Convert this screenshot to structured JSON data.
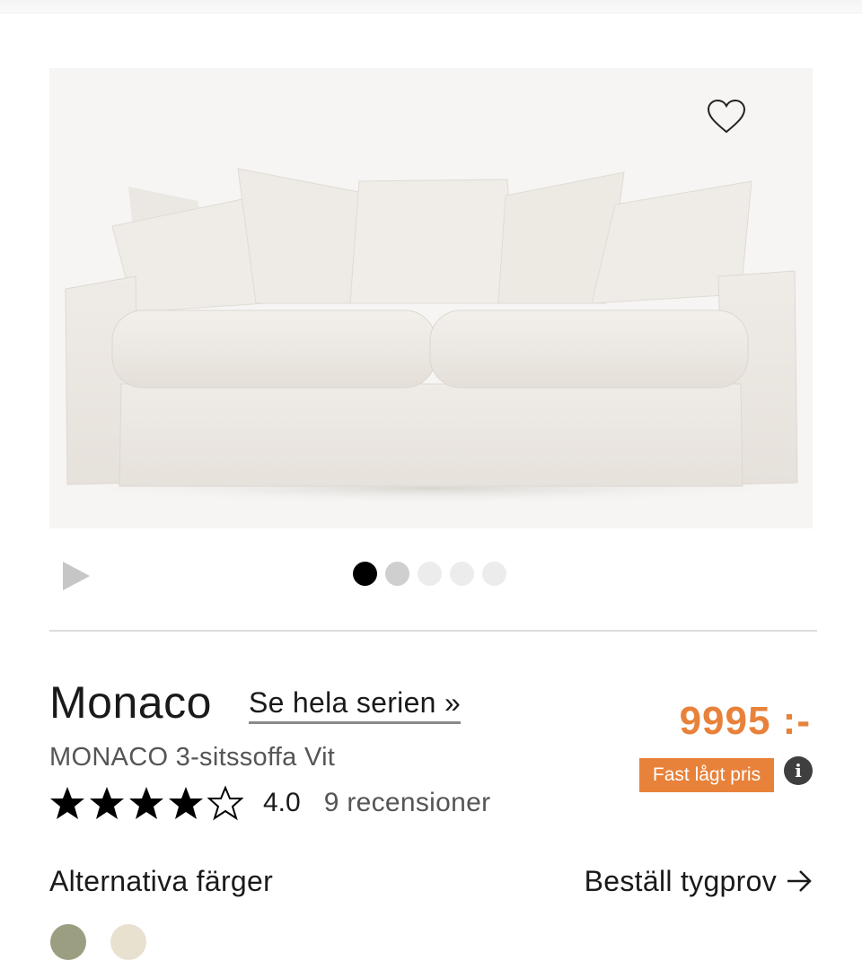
{
  "product": {
    "name": "Monaco",
    "series_link": "Se hela serien »",
    "subtitle": "MONACO 3-sitssoffa Vit",
    "rating_value": "4.0",
    "rating_stars": 4,
    "reviews": "9 recensioner",
    "price": "9995 :-",
    "price_badge": "Fast lågt pris",
    "image_alt": "Monaco 3-sitssoffa Vit"
  },
  "gallery": {
    "slide_count": 5,
    "active_slide": 1
  },
  "colors_section": {
    "label": "Alternativa färger",
    "sample_link": "Beställ tygprov",
    "swatches": [
      "#9b9e81",
      "#e9e1cf"
    ]
  },
  "theme": {
    "accent": "#e8823a",
    "text": "#1a1a1a"
  },
  "icons": {
    "favorite": "heart-icon",
    "play": "play-icon",
    "info": "info-icon",
    "arrow": "arrow-right-icon",
    "star": "star-icon"
  }
}
